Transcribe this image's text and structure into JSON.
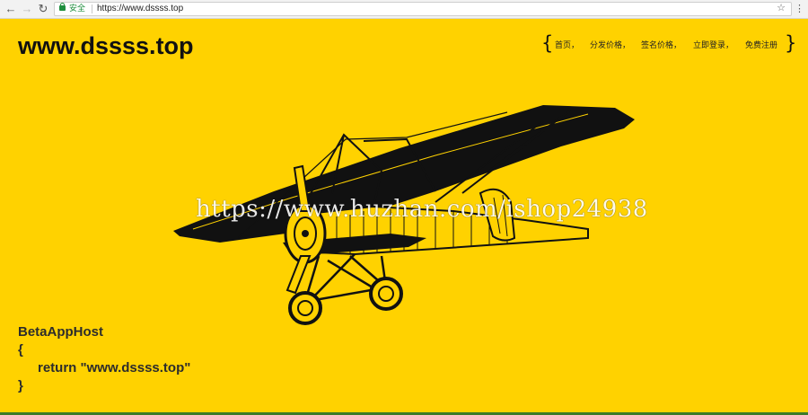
{
  "browser": {
    "secure_label": "安全",
    "url": "https://www.dssss.top"
  },
  "site": {
    "title": "www.dssss.top",
    "nav": {
      "open_brace": "{",
      "close_brace": "}",
      "items": [
        "首页，",
        "分发价格，",
        "签名价格，",
        "立即登录，",
        "免费注册"
      ]
    }
  },
  "watermark": "https://www.huzhan.com/ishop24938",
  "code": {
    "line1": "BetaAppHost",
    "line2": "{",
    "line3": "return \"www.dssss.top\"",
    "line4": "}"
  }
}
